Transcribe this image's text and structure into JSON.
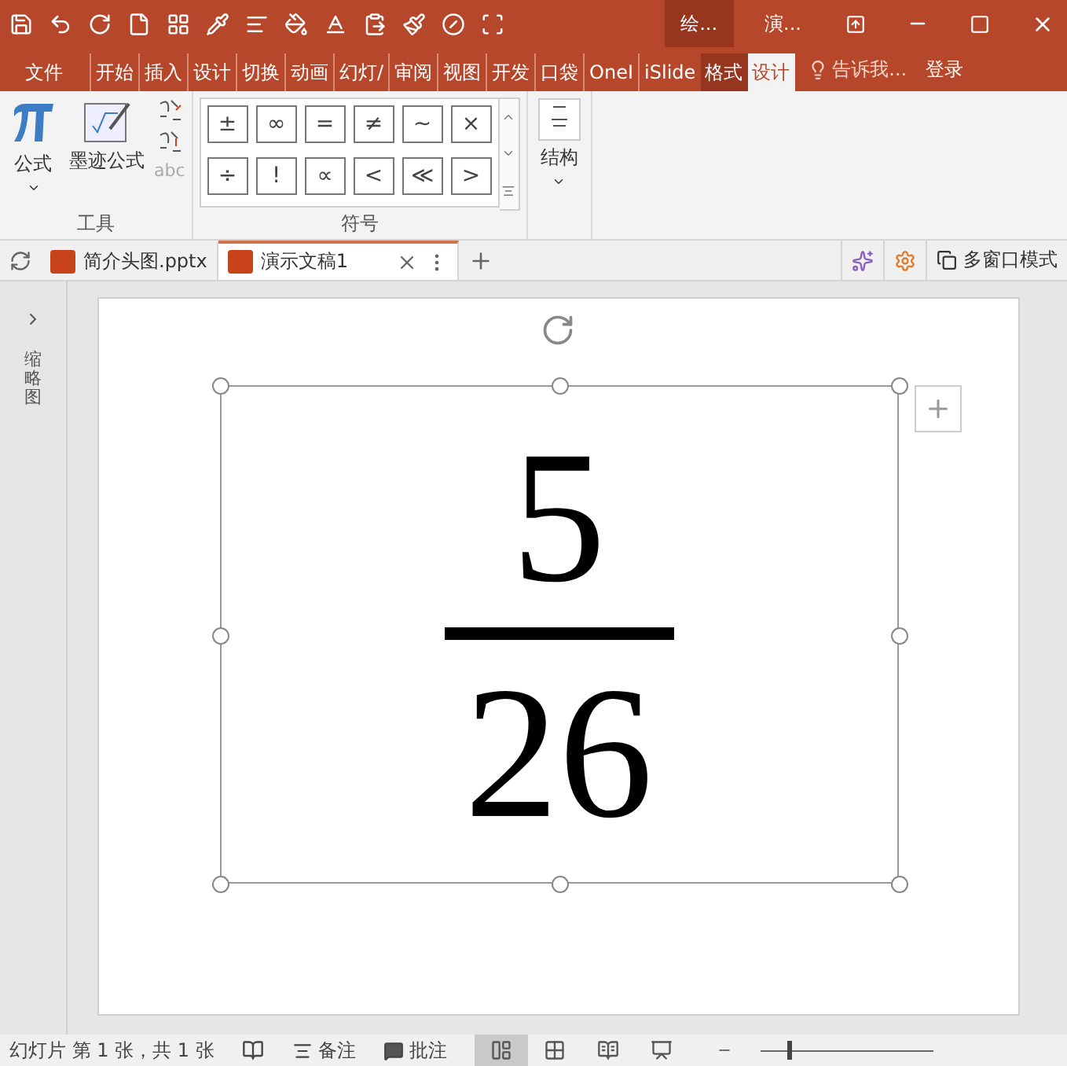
{
  "title_bar": {
    "tabs": [
      {
        "label": "绘...",
        "selected": true
      },
      {
        "label": "演...",
        "selected": false
      }
    ]
  },
  "ribbon_tabs": [
    {
      "label": "文件",
      "kind": "file",
      "selected": false
    },
    {
      "label": "开始",
      "kind": "normal",
      "selected": false
    },
    {
      "label": "插入",
      "kind": "normal",
      "selected": false
    },
    {
      "label": "设计",
      "kind": "normal",
      "selected": false
    },
    {
      "label": "切换",
      "kind": "normal",
      "selected": false
    },
    {
      "label": "动画",
      "kind": "normal",
      "selected": false
    },
    {
      "label": "幻灯/",
      "kind": "normal",
      "selected": false
    },
    {
      "label": "审阅",
      "kind": "normal",
      "selected": false
    },
    {
      "label": "视图",
      "kind": "normal",
      "selected": false
    },
    {
      "label": "开发",
      "kind": "normal",
      "selected": false
    },
    {
      "label": "口袋",
      "kind": "normal",
      "selected": false
    },
    {
      "label": "OneI",
      "kind": "normal",
      "selected": false
    },
    {
      "label": "iSlide",
      "kind": "normal",
      "selected": false
    },
    {
      "label": "格式",
      "kind": "contextual",
      "selected": false
    },
    {
      "label": "设计",
      "kind": "contextual",
      "selected": true
    }
  ],
  "tell_me": "告诉我...",
  "login": "登录",
  "ribbon": {
    "tools": {
      "label": "工具",
      "equation": "公式",
      "ink_equation": "墨迹公式",
      "abc": "abc"
    },
    "symbols": {
      "label": "符号",
      "items": [
        "±",
        "∞",
        "=",
        "≠",
        "~",
        "×",
        "÷",
        "!",
        "∝",
        "<",
        "≪",
        ">"
      ]
    },
    "structure": {
      "label": "结构"
    }
  },
  "doc_tabs": [
    {
      "label": "简介头图.pptx",
      "selected": false
    },
    {
      "label": "演示文稿1",
      "selected": true
    }
  ],
  "multi_window": "多窗口模式",
  "sidebar": {
    "label": "缩略图"
  },
  "slide": {
    "numerator": "5",
    "denominator": "26"
  },
  "status_bar": {
    "slide_info": "幻灯片 第 1 张，共 1 张",
    "notes": "备注",
    "comments": "批注",
    "views": [
      {
        "kind": "normal",
        "selected": true
      },
      {
        "kind": "sorter",
        "selected": false
      },
      {
        "kind": "reading",
        "selected": false
      },
      {
        "kind": "show",
        "selected": false
      }
    ],
    "zoom": {
      "level": 0.15
    }
  }
}
